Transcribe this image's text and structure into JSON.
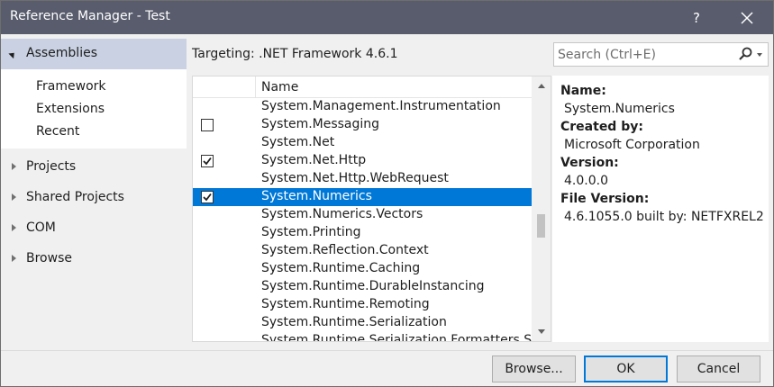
{
  "window": {
    "title": "Reference Manager - Test",
    "help_label": "?"
  },
  "nav": {
    "assemblies_label": "Assemblies",
    "assemblies_children": [
      "Framework",
      "Extensions",
      "Recent"
    ],
    "projects_label": "Projects",
    "shared_projects_label": "Shared Projects",
    "com_label": "COM",
    "browse_label": "Browse"
  },
  "header": {
    "targeting": "Targeting: .NET Framework 4.6.1"
  },
  "search": {
    "placeholder": "Search (Ctrl+E)"
  },
  "list": {
    "column_name": "Name",
    "rows": [
      {
        "name": "System.Management.Instrumentation",
        "checkbox": false,
        "checked": false,
        "selected": false
      },
      {
        "name": "System.Messaging",
        "checkbox": true,
        "checked": false,
        "selected": false
      },
      {
        "name": "System.Net",
        "checkbox": false,
        "checked": false,
        "selected": false
      },
      {
        "name": "System.Net.Http",
        "checkbox": true,
        "checked": true,
        "selected": false
      },
      {
        "name": "System.Net.Http.WebRequest",
        "checkbox": false,
        "checked": false,
        "selected": false
      },
      {
        "name": "System.Numerics",
        "checkbox": true,
        "checked": true,
        "selected": true
      },
      {
        "name": "System.Numerics.Vectors",
        "checkbox": false,
        "checked": false,
        "selected": false
      },
      {
        "name": "System.Printing",
        "checkbox": false,
        "checked": false,
        "selected": false
      },
      {
        "name": "System.Reflection.Context",
        "checkbox": false,
        "checked": false,
        "selected": false
      },
      {
        "name": "System.Runtime.Caching",
        "checkbox": false,
        "checked": false,
        "selected": false
      },
      {
        "name": "System.Runtime.DurableInstancing",
        "checkbox": false,
        "checked": false,
        "selected": false
      },
      {
        "name": "System.Runtime.Remoting",
        "checkbox": false,
        "checked": false,
        "selected": false
      },
      {
        "name": "System.Runtime.Serialization",
        "checkbox": false,
        "checked": false,
        "selected": false
      },
      {
        "name": "System.Runtime.Serialization.Formatters.S",
        "checkbox": false,
        "checked": false,
        "selected": false
      }
    ]
  },
  "details": {
    "name_label": "Name:",
    "name_value": "System.Numerics",
    "created_label": "Created by:",
    "created_value": "Microsoft Corporation",
    "version_label": "Version:",
    "version_value": "4.0.0.0",
    "file_version_label": "File Version:",
    "file_version_value": "4.6.1055.0 built by: NETFXREL2"
  },
  "buttons": {
    "browse": "Browse...",
    "ok": "OK",
    "cancel": "Cancel"
  },
  "colors": {
    "titlebar": "#585c6c",
    "selection": "#0078d7",
    "nav_selected": "#c9d1e2"
  }
}
